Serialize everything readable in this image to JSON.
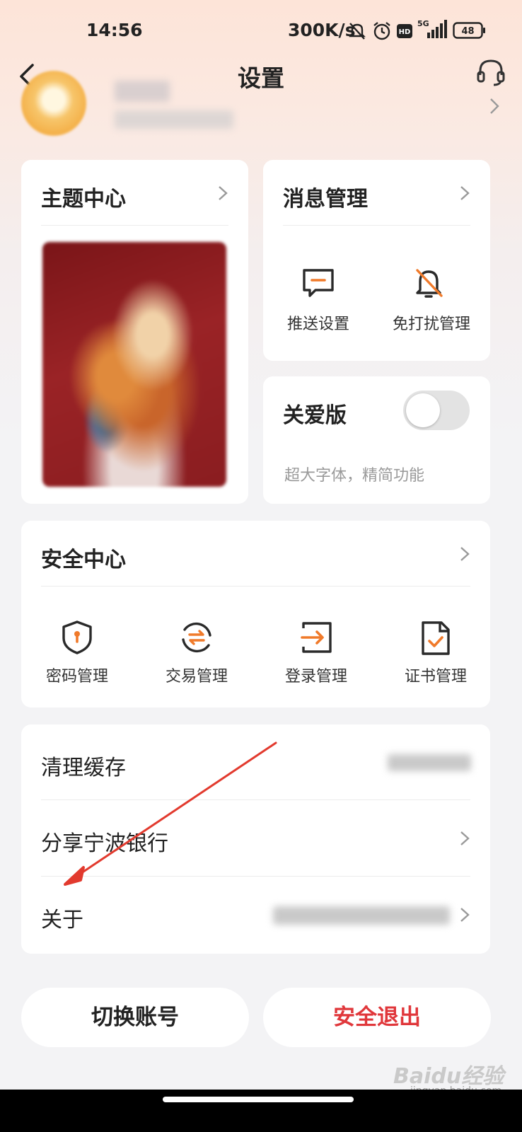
{
  "status_bar": {
    "time": "14:56",
    "net_rate": "300K/s",
    "network": "5G",
    "hd_badge": "HD",
    "battery": "48"
  },
  "header": {
    "title": "设置"
  },
  "theme_card": {
    "title": "主题中心"
  },
  "message_card": {
    "title": "消息管理",
    "items": [
      {
        "label": "推送设置",
        "icon": "message-icon"
      },
      {
        "label": "免打扰管理",
        "icon": "bell-off-icon"
      }
    ]
  },
  "care_card": {
    "title": "关爱版",
    "subtitle": "超大字体，精简功能",
    "toggle_on": false
  },
  "security_card": {
    "title": "安全中心",
    "items": [
      {
        "label": "密码管理",
        "icon": "shield-lock-icon"
      },
      {
        "label": "交易管理",
        "icon": "exchange-icon"
      },
      {
        "label": "登录管理",
        "icon": "login-icon"
      },
      {
        "label": "证书管理",
        "icon": "certificate-icon"
      }
    ]
  },
  "list": {
    "clear_cache": "清理缓存",
    "share": "分享宁波银行",
    "about": "关于"
  },
  "buttons": {
    "switch_account": "切换账号",
    "logout": "安全退出"
  },
  "watermark": {
    "brand": "Baidu经验",
    "url": "jingyan.baidu.com"
  },
  "colors": {
    "accent": "#f07a2a",
    "danger": "#e0373b",
    "icon_dark": "#2a2a2a"
  }
}
